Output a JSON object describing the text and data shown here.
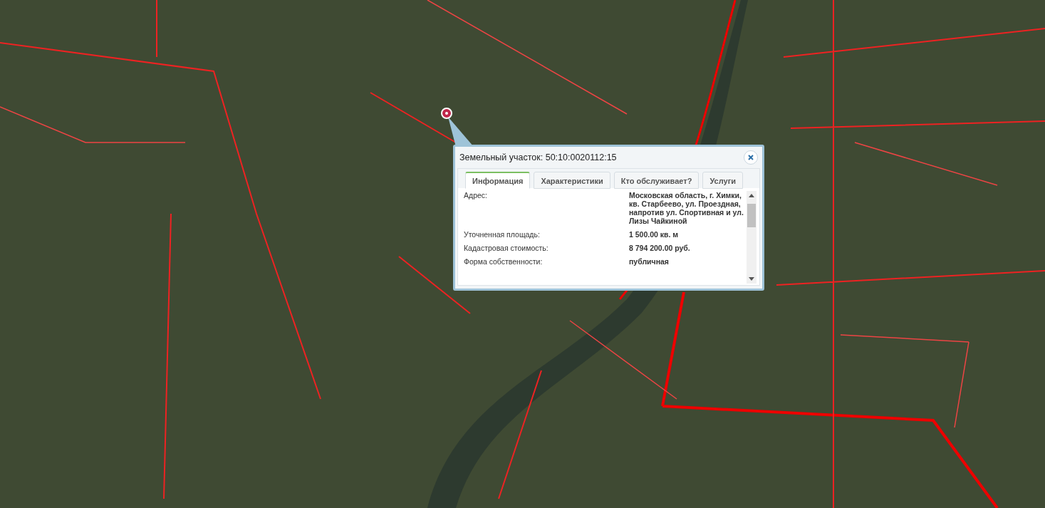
{
  "popup": {
    "title": "Земельный участок: 50:10:0020112:15",
    "tabs": [
      {
        "label": "Информация",
        "selected": true
      },
      {
        "label": "Характеристики",
        "selected": false
      },
      {
        "label": "Кто обслуживает?",
        "selected": false
      },
      {
        "label": "Услуги",
        "selected": false
      }
    ],
    "fields": [
      {
        "label": "Адрес:",
        "value": "Московская область, г. Химки, кв. Старбеево, ул. Проездная, напротив ул. Спортивная и ул. Лизы Чайкиной"
      },
      {
        "label": "Уточненная площадь:",
        "value": "1 500.00 кв. м"
      },
      {
        "label": "Кадастровая стоимость:",
        "value": "8 794 200.00 руб."
      },
      {
        "label": "Форма собственности:",
        "value": "публичная"
      }
    ]
  }
}
